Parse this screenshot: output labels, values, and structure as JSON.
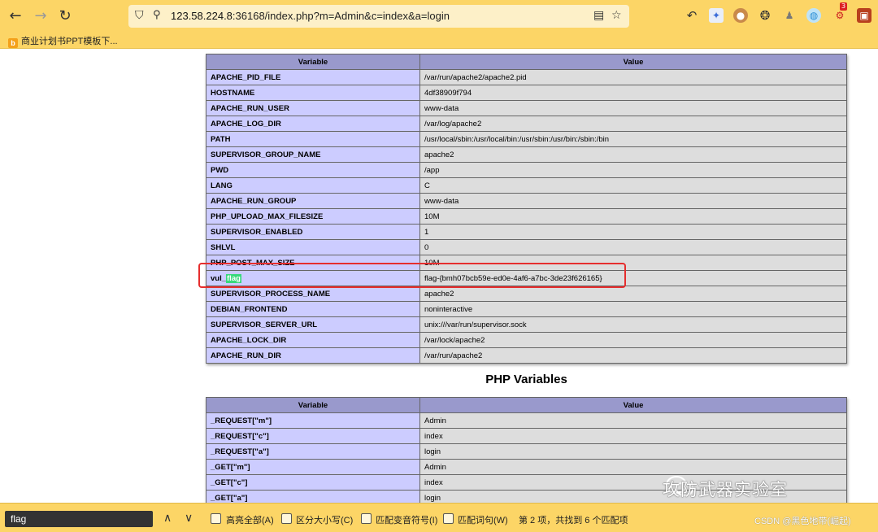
{
  "browser": {
    "url_host": "123.58.224.8",
    "url_rest": ":36168/index.php?m=Admin&c=index&a=login",
    "bookmark": "商业计划书PPT模板下...",
    "ext_badge": "3"
  },
  "env_table": {
    "headers": [
      "Variable",
      "Value"
    ],
    "rows": [
      [
        "APACHE_PID_FILE",
        "/var/run/apache2/apache2.pid"
      ],
      [
        "HOSTNAME",
        "4df38909f794"
      ],
      [
        "APACHE_RUN_USER",
        "www-data"
      ],
      [
        "APACHE_LOG_DIR",
        "/var/log/apache2"
      ],
      [
        "PATH",
        "/usr/local/sbin:/usr/local/bin:/usr/sbin:/usr/bin:/sbin:/bin"
      ],
      [
        "SUPERVISOR_GROUP_NAME",
        "apache2"
      ],
      [
        "PWD",
        "/app"
      ],
      [
        "LANG",
        "C"
      ],
      [
        "APACHE_RUN_GROUP",
        "www-data"
      ],
      [
        "PHP_UPLOAD_MAX_FILESIZE",
        "10M"
      ],
      [
        "SUPERVISOR_ENABLED",
        "1"
      ],
      [
        "SHLVL",
        "0"
      ],
      [
        "PHP_POST_MAX_SIZE",
        "10M"
      ],
      [
        "vul_flag",
        "flag-{bmh07bcb59e-ed0e-4af6-a7bc-3de23f626165}"
      ],
      [
        "SUPERVISOR_PROCESS_NAME",
        "apache2"
      ],
      [
        "DEBIAN_FRONTEND",
        "noninteractive"
      ],
      [
        "SUPERVISOR_SERVER_URL",
        "unix:///var/run/supervisor.sock"
      ],
      [
        "APACHE_LOCK_DIR",
        "/var/lock/apache2"
      ],
      [
        "APACHE_RUN_DIR",
        "/var/run/apache2"
      ]
    ],
    "flag_prefix": "vul_",
    "flag_match": "flag"
  },
  "php_section": {
    "title": "PHP Variables",
    "headers": [
      "Variable",
      "Value"
    ],
    "rows": [
      [
        "_REQUEST[\"m\"]",
        "Admin"
      ],
      [
        "_REQUEST[\"c\"]",
        "index"
      ],
      [
        "_REQUEST[\"a\"]",
        "login"
      ],
      [
        "_GET[\"m\"]",
        "Admin"
      ],
      [
        "_GET[\"c\"]",
        "index"
      ],
      [
        "_GET[\"a\"]",
        "login"
      ]
    ]
  },
  "findbar": {
    "query": "flag",
    "options": [
      "高亮全部(A)",
      "区分大小写(C)",
      "匹配变音符号(I)",
      "匹配词句(W)"
    ],
    "status": "第 2 项，共找到 6 个匹配项"
  },
  "watermark": {
    "text": "攻防武器实验室",
    "csdn": "CSDN @黑色地带(崛起)"
  }
}
